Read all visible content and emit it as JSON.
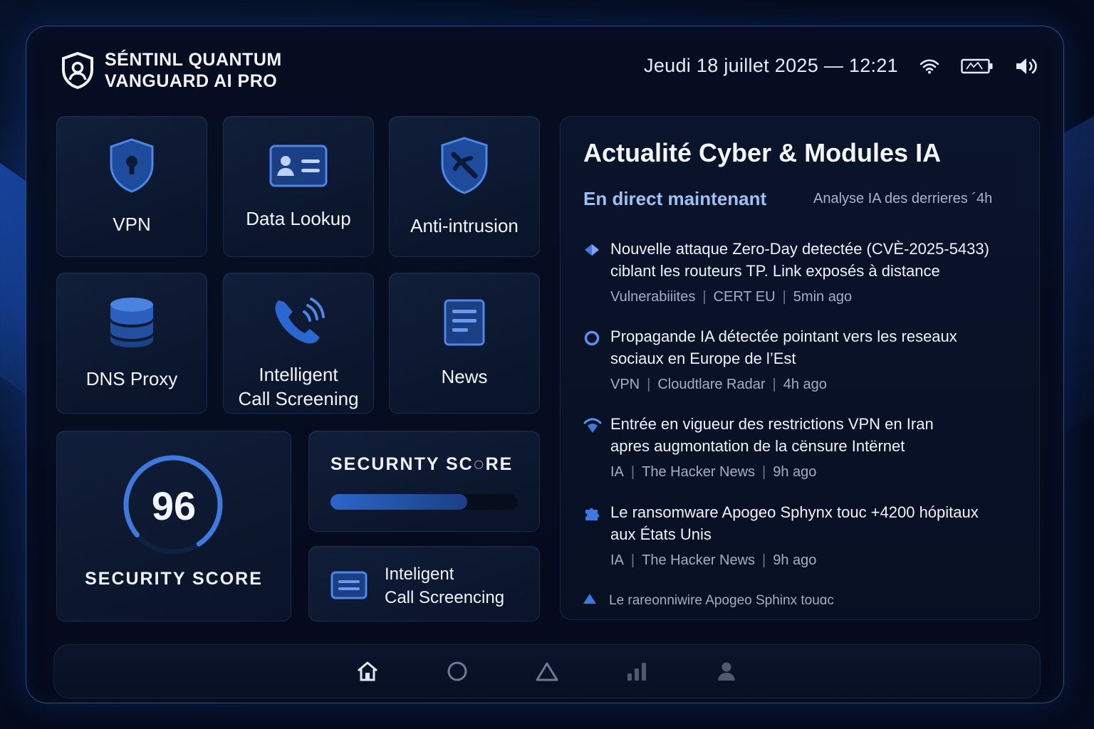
{
  "app": {
    "name_line1": "SÉNTINL QUANTUM",
    "name_line2": "VANGUARD AI PRO",
    "logo_icon": "shield-user-icon"
  },
  "status_bar": {
    "datetime": "Jeudi 18 juillet 2025 — 12:21",
    "icons": [
      "wifi-icon",
      "battery-icon",
      "volume-icon"
    ]
  },
  "tiles": [
    {
      "label": "VPN",
      "icon": "shield-lock-icon"
    },
    {
      "label": "Data Lookup",
      "icon": "id-card-icon"
    },
    {
      "label": "Anti-intrusion",
      "icon": "shield-block-icon"
    },
    {
      "label": "DNS Proxy",
      "icon": "database-icon"
    },
    {
      "label_line1": "Intelligent",
      "label_line2": "Call Screening",
      "icon": "phone-ring-icon"
    },
    {
      "label": "News",
      "icon": "document-icon"
    }
  ],
  "security_score": {
    "value": "96",
    "title": "SECURITY SCORE"
  },
  "score_bar": {
    "title": "SECURNTY SC◌RE",
    "progress": 0.73
  },
  "call_card": {
    "line1": "Inteligent",
    "line2": "Call Screencing",
    "icon": "list-card-icon"
  },
  "news": {
    "title": "Actualité Cyber & Modules IA",
    "live_label": "En direct maintenant",
    "analysis_label": "Analyse IA des derrieres ´4h",
    "items": [
      {
        "icon": "diamond-icon",
        "headline_line1": "Nouvelle attaque Zero-Day detectée (CVÈ-2025-5433)",
        "headline_line2": "ciblant les routeurs TP. Link exposés à distance",
        "tag": "Vulnerabiiites",
        "source": "CERT EU",
        "time": "5min ago"
      },
      {
        "icon": "circle-icon",
        "headline_line1": "Propagande IA détectée pointant vers les reseaux",
        "headline_line2": "sociaux en Europe de l’Est",
        "tag": "VPN",
        "source": "Cloudtlare Radar",
        "time": "4h ago"
      },
      {
        "icon": "wifi-shield-icon",
        "headline_line1": "Entrée en vigueur des restrictions VPN en Iran",
        "headline_line2": "apres augmontation de la cënsure Intërnet",
        "tag": "IA",
        "source": "The Hacker News",
        "time": "9h ago"
      },
      {
        "icon": "puzzle-icon",
        "headline_line1": "Le ransomware Apogeo Sphуnx touc +4200 hópitaux",
        "headline_line2": "aux États Unis",
        "tag": "IA",
        "source": "The Hacker News",
        "time": "9h ago"
      }
    ],
    "last_item": {
      "icon": "triangle-icon",
      "text": "Le rareonniwire Apogeo Sphinx touɑc"
    }
  },
  "bottom_nav": [
    "home-icon",
    "circle-icon",
    "triangle-icon",
    "bar-chart-icon",
    "user-icon"
  ],
  "colors": {
    "accent": "#2f6fd6",
    "accent_light": "#9ec0f5",
    "background": "#050b1c",
    "panel": "#0c162e"
  }
}
